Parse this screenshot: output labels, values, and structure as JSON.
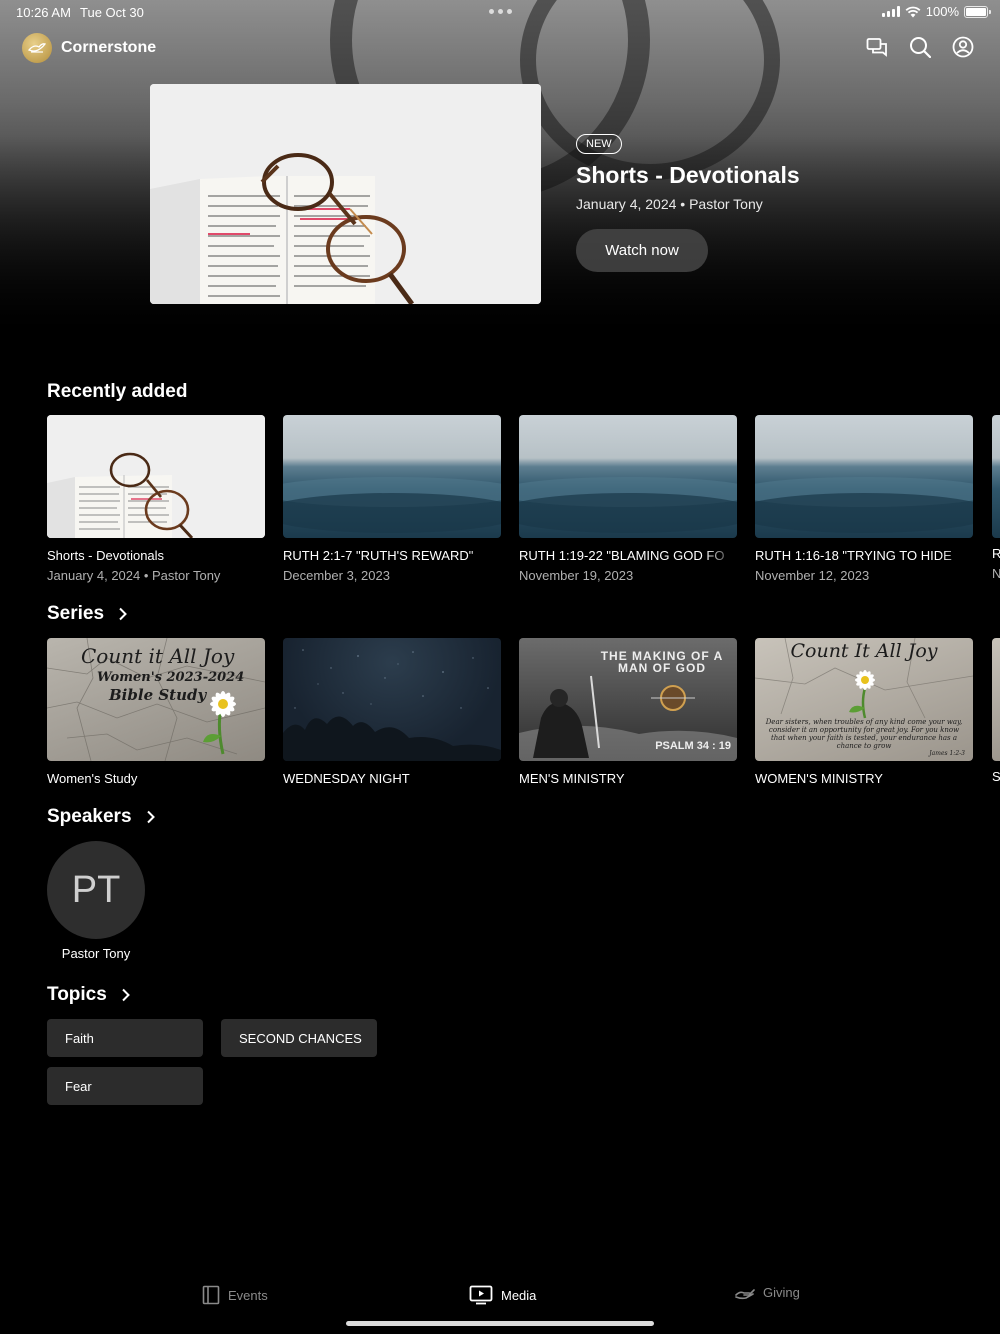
{
  "status": {
    "time": "10:26 AM",
    "date": "Tue Oct 30",
    "battery": "100%"
  },
  "header": {
    "app_name": "Cornerstone",
    "icons": [
      "chat-icon",
      "search-icon",
      "account-icon"
    ]
  },
  "hero": {
    "badge": "NEW",
    "title": "Shorts - Devotionals",
    "meta": "January 4, 2024 • Pastor Tony",
    "watch_label": "Watch now"
  },
  "recently_added": {
    "title": "Recently added",
    "items": [
      {
        "title": "Shorts - Devotionals",
        "subtitle": "January 4, 2024 • Pastor Tony"
      },
      {
        "title": "RUTH 2:1-7 \"RUTH'S REWARD\"",
        "subtitle": "December 3, 2023"
      },
      {
        "title": "RUTH 1:19-22 \"BLAMING GOD FO",
        "subtitle": "November 19, 2023"
      },
      {
        "title": "RUTH 1:16-18 \"TRYING TO HIDE",
        "subtitle": "November 12, 2023"
      }
    ],
    "peek": {
      "title": "R",
      "subtitle": "N"
    }
  },
  "series": {
    "title": "Series",
    "items": [
      {
        "title": "Women's Study",
        "art_line1": "Count it All Joy",
        "art_line2": "Women's 2023-2024",
        "art_line3": "Bible Study"
      },
      {
        "title": "WEDNESDAY NIGHT"
      },
      {
        "title": "MEN'S MINISTRY",
        "art_line1": "THE MAKING OF A",
        "art_line2": "MAN OF GOD",
        "art_line3": "PSALM 34 : 19"
      },
      {
        "title": "WOMEN'S MINISTRY",
        "art_line1": "Count It All Joy",
        "art_line2": "Dear sisters, when troubles of any kind come your way, consider it an opportunity for great joy. For you know that when your faith is tested, your endurance has a chance to grow",
        "art_line3": "James 1:2-3"
      }
    ],
    "peek": {
      "title": "S"
    }
  },
  "speakers": {
    "title": "Speakers",
    "items": [
      {
        "initials": "PT",
        "name": "Pastor Tony"
      }
    ]
  },
  "topics": {
    "title": "Topics",
    "items": [
      "Faith",
      "SECOND CHANCES",
      "Fear"
    ]
  },
  "tabs": [
    {
      "label": "Events",
      "icon": "events-icon",
      "active": false
    },
    {
      "label": "Media",
      "icon": "media-icon",
      "active": true
    },
    {
      "label": "Giving",
      "icon": "giving-icon",
      "active": false
    }
  ],
  "colors": {
    "background": "#000000",
    "card": "#2c2c2c",
    "button": "#464646",
    "logo": "#c9a653"
  }
}
